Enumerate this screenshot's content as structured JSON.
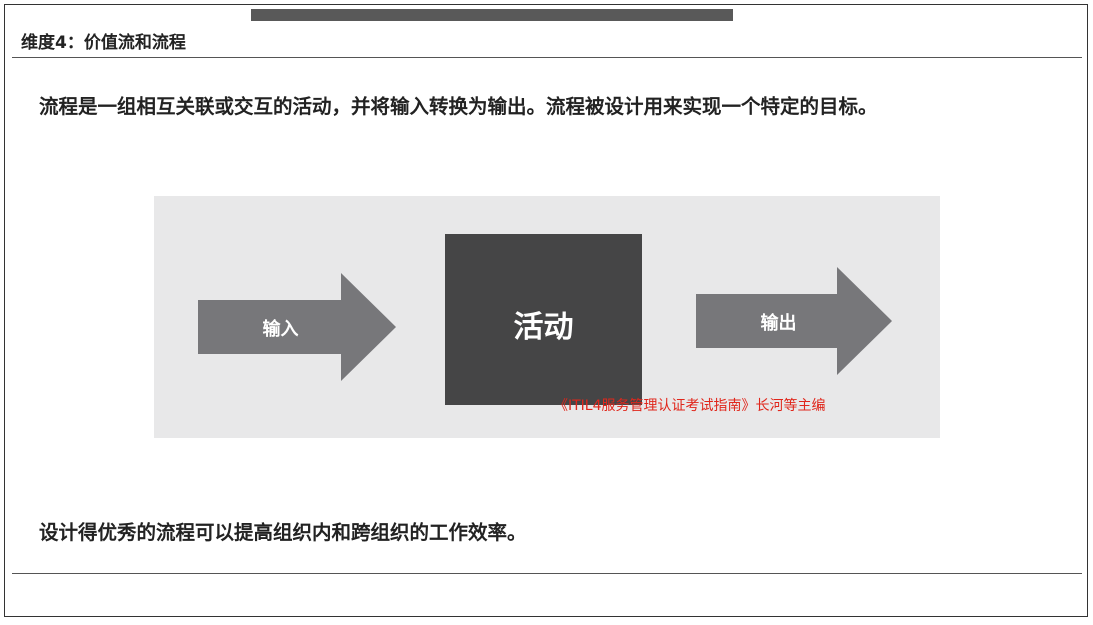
{
  "section": {
    "title": "维度4：价值流和流程"
  },
  "intro": {
    "text": "流程是一组相互关联或交互的活动，并将输入转换为输出。流程被设计用来实现一个特定的目标。"
  },
  "diagram": {
    "input_label": "输入",
    "activity_label": "活动",
    "output_label": "输出",
    "watermark": "《ITIL4服务管理认证考试指南》长河等主编"
  },
  "closing": {
    "text": "设计得优秀的流程可以提高组织内和跨组织的工作效率。"
  },
  "colors": {
    "arrow": "#77777a",
    "activity_box": "#454546",
    "diagram_bg": "#e8e8e9",
    "watermark": "#e0261b",
    "top_bar": "#595959"
  }
}
